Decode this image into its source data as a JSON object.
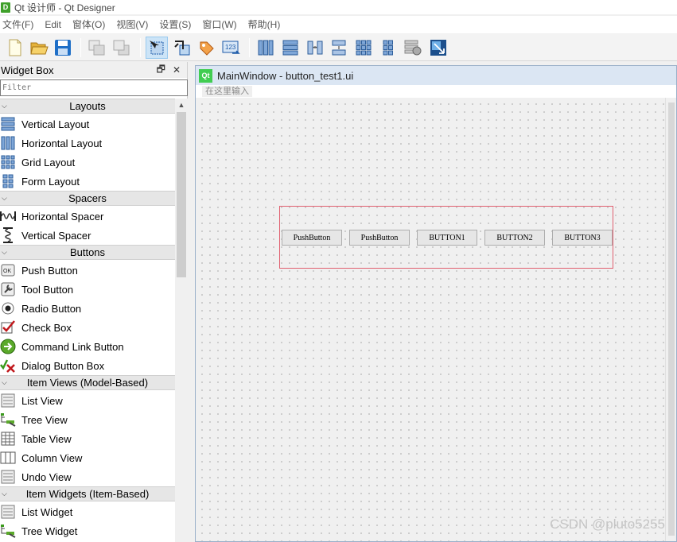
{
  "app": {
    "window_title": "Qt 设计师 - Qt Designer",
    "icon_letter": "D"
  },
  "menu": [
    "文件(F)",
    "Edit",
    "窗体(O)",
    "视图(V)",
    "设置(S)",
    "窗口(W)",
    "帮助(H)"
  ],
  "toolbar": {
    "icons": [
      "new-file-icon",
      "open-folder-icon",
      "save-icon",
      "send-to-back-icon",
      "bring-to-front-icon",
      "edit-widgets-icon",
      "edit-signals-slots-icon",
      "edit-buddies-icon",
      "edit-tab-order-icon",
      "horizontal-layout-icon",
      "vertical-layout-icon",
      "horizontal-splitter-icon",
      "vertical-splitter-icon",
      "grid-layout-icon",
      "form-layout-icon",
      "break-layout-icon",
      "adjust-size-icon"
    ],
    "checked": "edit-widgets-icon"
  },
  "widget_box": {
    "title": "Widget Box",
    "float_glyph": "🗗",
    "close_glyph": "✕",
    "filter_placeholder": "Filter",
    "categories": [
      {
        "label": "Layouts",
        "items": [
          "Vertical Layout",
          "Horizontal Layout",
          "Grid Layout",
          "Form Layout"
        ]
      },
      {
        "label": "Spacers",
        "items": [
          "Horizontal Spacer",
          "Vertical Spacer"
        ]
      },
      {
        "label": "Buttons",
        "items": [
          "Push Button",
          "Tool Button",
          "Radio Button",
          "Check Box",
          "Command Link Button",
          "Dialog Button Box"
        ]
      },
      {
        "label": "Item Views (Model-Based)",
        "items": [
          "List View",
          "Tree View",
          "Table View",
          "Column View",
          "Undo View"
        ]
      },
      {
        "label": "Item Widgets (Item-Based)",
        "items": [
          "List Widget",
          "Tree Widget"
        ]
      }
    ]
  },
  "form": {
    "title": "MainWindow - button_test1.ui",
    "qt_badge": "Qt",
    "type_here": "在这里输入",
    "buttons": [
      "PushButton",
      "PushButton",
      "BUTTON1",
      "BUTTON2",
      "BUTTON3"
    ]
  },
  "watermark": "CSDN @pluto5255",
  "colors": {
    "layout_border": "#e06070",
    "form_title_bg": "#dbe6f3",
    "qt_green": "#41cd52"
  }
}
